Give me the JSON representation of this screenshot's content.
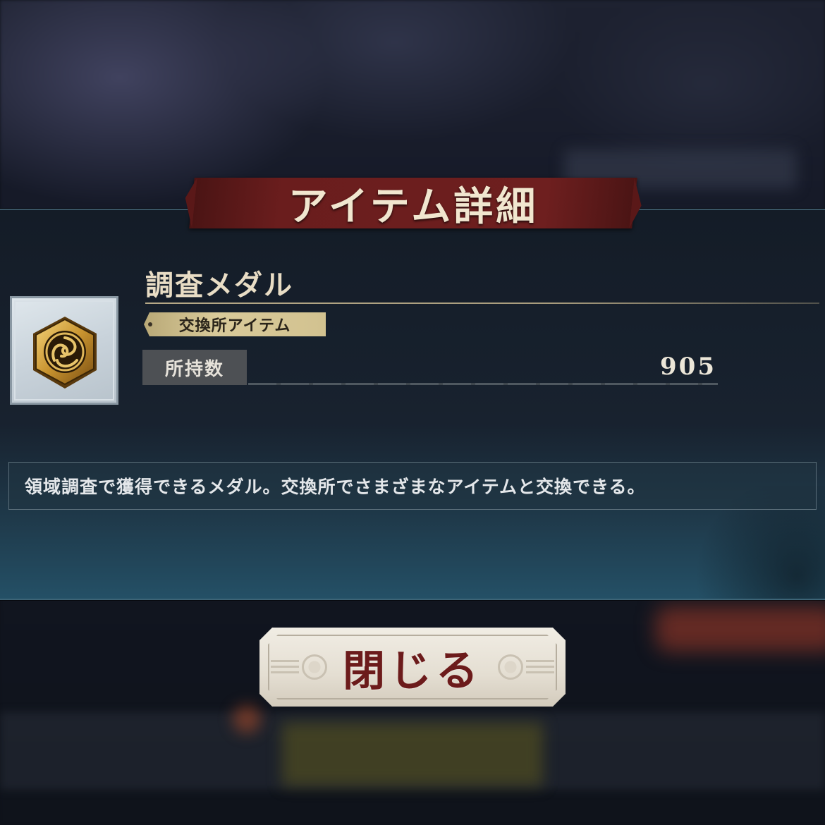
{
  "dialog": {
    "title": "アイテム詳細",
    "item": {
      "name": "調査メダル",
      "tag": "交換所アイテム",
      "icon": "medal-icon",
      "owned_label": "所持数",
      "owned_value": "905",
      "description": "領域調査で獲得できるメダル。交換所でさまざまなアイテムと交換できる。"
    },
    "close_label": "閉じる"
  },
  "colors": {
    "title_banner": "#6e1f1f",
    "close_text": "#6c1b1b",
    "tag_bg": "#d2c290",
    "panel_bg": "#18222f"
  }
}
